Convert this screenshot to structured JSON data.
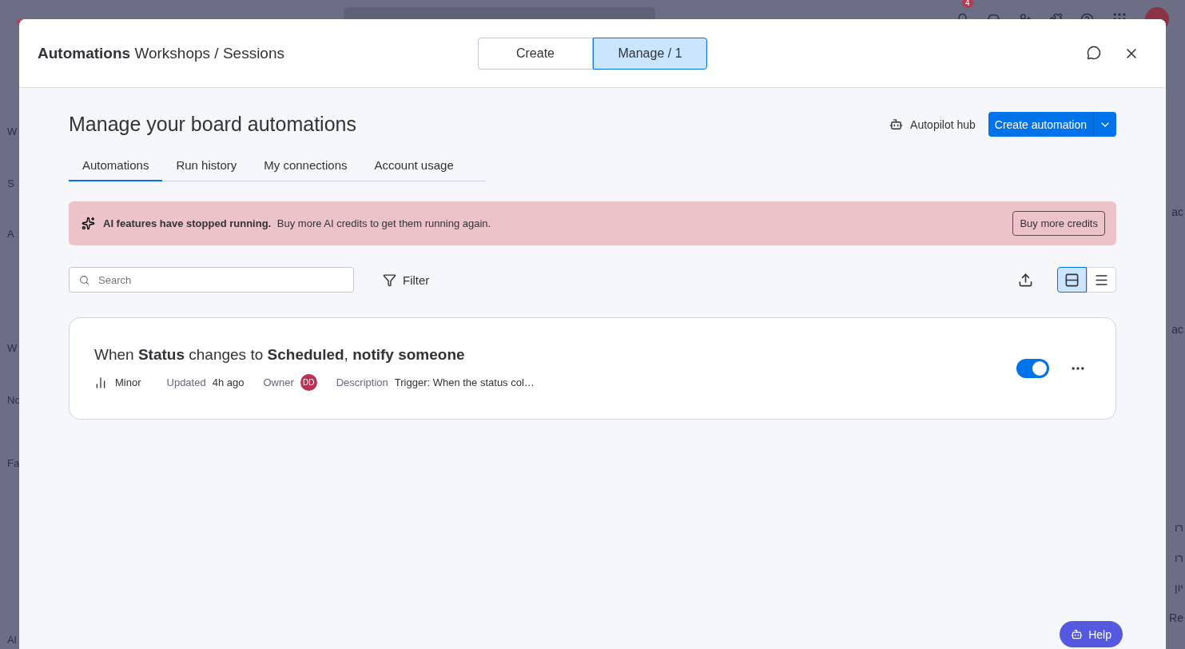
{
  "background_app": {
    "notification_badge": "4",
    "left_fragments": [
      "W",
      "S",
      "A",
      "W",
      "No",
      "Fa",
      "Al"
    ],
    "right_fragments": [
      "ac",
      "ac",
      "רו",
      "רו",
      "יון",
      "Re"
    ]
  },
  "modal": {
    "title": "Automations",
    "breadcrumb": "Workshops / Sessions",
    "mode_tabs": [
      {
        "label": "Create",
        "selected": false
      },
      {
        "label": "Manage / 1",
        "selected": true
      }
    ]
  },
  "heading": "Manage your board automations",
  "autopilot_link": "Autopilot hub",
  "create_button": "Create automation",
  "tabs": [
    {
      "label": "Automations",
      "selected": true
    },
    {
      "label": "Run history",
      "selected": false
    },
    {
      "label": "My connections",
      "selected": false
    },
    {
      "label": "Account usage",
      "selected": false
    }
  ],
  "alert": {
    "text": "**AI features have stopped running.** Buy more AI credits to get them running again.",
    "button": "Buy more credits"
  },
  "search": {
    "placeholder": "Search"
  },
  "filter": "Filter",
  "views": [
    {
      "kind": "cards",
      "selected": true
    },
    {
      "kind": "list",
      "selected": false
    }
  ],
  "automations": [
    {
      "title": "When **Status** changes to **Scheduled**, **notify someone**",
      "priority": "Minor",
      "updated_label": "Updated",
      "updated": "4h ago",
      "owner_label": "Owner",
      "owner": "DD",
      "description_label": "Description",
      "description": "Trigger: When the status col…",
      "on": true
    }
  ],
  "help": "Help"
}
